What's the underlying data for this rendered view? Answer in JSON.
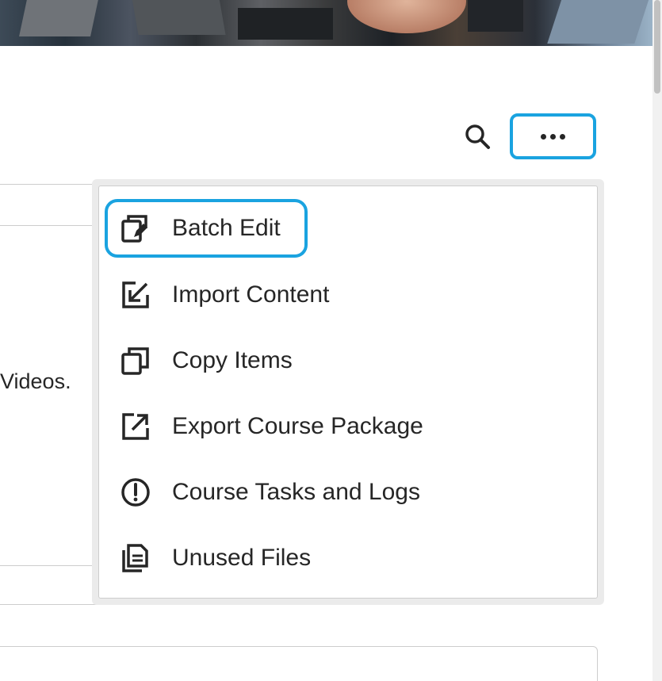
{
  "header": {
    "banner_alt": "course banner image"
  },
  "toolbar": {
    "search_icon": "search-icon",
    "more_icon": "more-options-icon"
  },
  "background": {
    "partial_text": "Videos."
  },
  "menu": {
    "items": [
      {
        "label": "Batch Edit",
        "icon": "batch-edit-icon"
      },
      {
        "label": "Import Content",
        "icon": "import-icon"
      },
      {
        "label": "Copy Items",
        "icon": "copy-icon"
      },
      {
        "label": "Export Course Package",
        "icon": "export-icon"
      },
      {
        "label": "Course Tasks and Logs",
        "icon": "alert-circle-icon"
      },
      {
        "label": "Unused Files",
        "icon": "files-icon"
      }
    ]
  },
  "colors": {
    "focus_ring": "#1aa3e0",
    "text": "#262626",
    "border": "#cdcdcd"
  }
}
